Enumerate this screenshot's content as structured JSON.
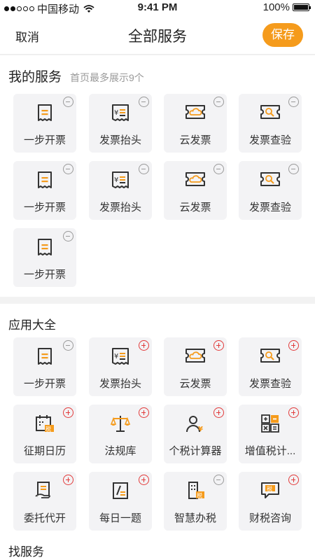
{
  "status_bar": {
    "carrier": "中国移动",
    "time": "9:41 PM",
    "battery": "100%"
  },
  "nav": {
    "cancel": "取消",
    "title": "全部服务",
    "save": "保存"
  },
  "my_services": {
    "title": "我的服务",
    "subtitle": "首页最多展示9个",
    "items": [
      {
        "label": "一步开票",
        "icon": "receipt-icon",
        "action": "remove"
      },
      {
        "label": "发票抬头",
        "icon": "invoice-header-icon",
        "action": "remove"
      },
      {
        "label": "云发票",
        "icon": "cloud-ticket-icon",
        "action": "remove"
      },
      {
        "label": "发票查验",
        "icon": "ticket-search-icon",
        "action": "remove"
      },
      {
        "label": "一步开票",
        "icon": "receipt-icon",
        "action": "remove"
      },
      {
        "label": "发票抬头",
        "icon": "invoice-header-icon",
        "action": "remove"
      },
      {
        "label": "云发票",
        "icon": "cloud-ticket-icon",
        "action": "remove"
      },
      {
        "label": "发票查验",
        "icon": "ticket-search-icon",
        "action": "remove"
      },
      {
        "label": "一步开票",
        "icon": "receipt-icon",
        "action": "remove"
      }
    ]
  },
  "all_apps": {
    "title": "应用大全",
    "items": [
      {
        "label": "一步开票",
        "icon": "receipt-icon",
        "action": "remove"
      },
      {
        "label": "发票抬头",
        "icon": "invoice-header-icon",
        "action": "add"
      },
      {
        "label": "云发票",
        "icon": "cloud-ticket-icon",
        "action": "add"
      },
      {
        "label": "发票查验",
        "icon": "ticket-search-icon",
        "action": "add"
      },
      {
        "label": "征期日历",
        "icon": "tax-calendar-icon",
        "action": "add"
      },
      {
        "label": "法规库",
        "icon": "scales-icon",
        "action": "add"
      },
      {
        "label": "个税计算器",
        "icon": "person-tax-icon",
        "action": "add"
      },
      {
        "label": "增值税计...",
        "icon": "calculator-icon",
        "action": "add"
      },
      {
        "label": "委托代开",
        "icon": "delegate-icon",
        "action": "add"
      },
      {
        "label": "每日一题",
        "icon": "daily-question-icon",
        "action": "add"
      },
      {
        "label": "智慧办税",
        "icon": "smart-tax-icon",
        "action": "remove"
      },
      {
        "label": "财税咨询",
        "icon": "consult-chat-icon",
        "action": "add"
      }
    ]
  },
  "find_services": {
    "title": "找服务"
  },
  "colors": {
    "accent": "#f59b1c",
    "icon_dark": "#333333",
    "add": "#e23b3b",
    "remove": "#9a9a9a"
  }
}
